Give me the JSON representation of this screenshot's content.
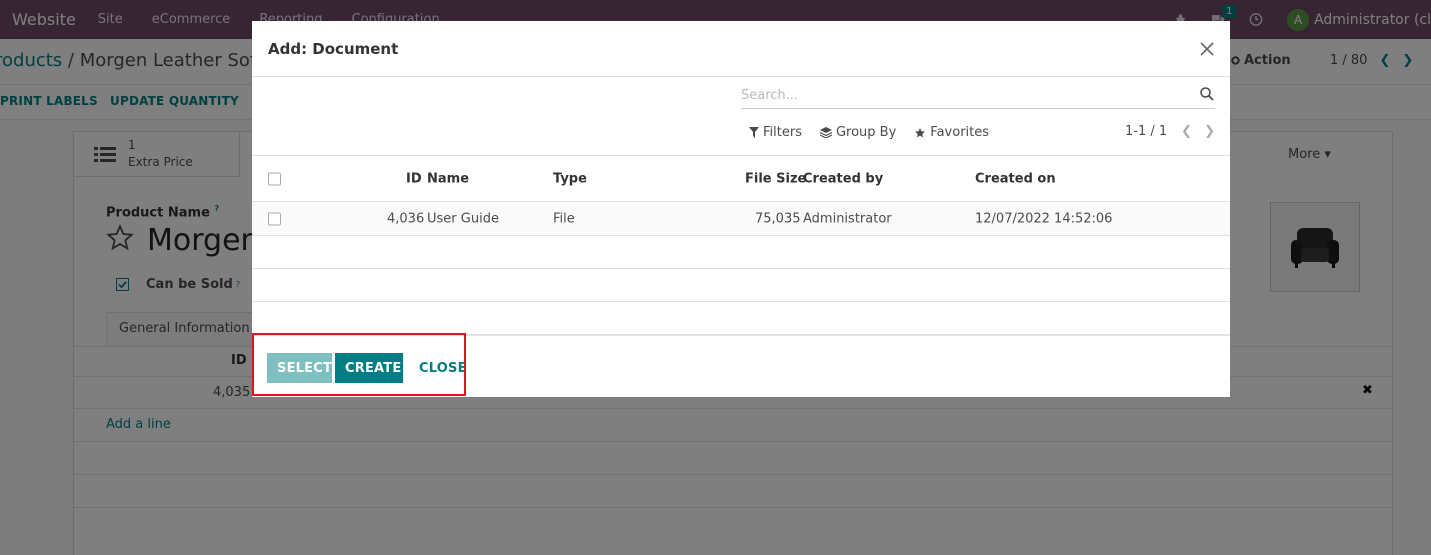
{
  "navbar": {
    "brand": "Website",
    "menu": [
      "Site",
      "eCommerce",
      "Reporting",
      "Configuration"
    ],
    "chat_badge": "1",
    "avatar_letter": "A",
    "user": "Administrator (cl"
  },
  "control": {
    "breadcrumb_parent": "roducts",
    "breadcrumb_sep": " / ",
    "breadcrumb_current": "Morgen Leather Sofa",
    "action_label": "Action",
    "pager": "1 / 80"
  },
  "statusbar": {
    "print_labels": "PRINT LABELS",
    "update_quantity": "UPDATE QUANTITY"
  },
  "form": {
    "stat_value": "1",
    "stat_label": "Extra Price",
    "more_label": "More",
    "product_name_label": "Product Name",
    "help_mark": "?",
    "product_name": "Morgen",
    "can_be_sold": "Can be Sold",
    "tab_general": "General Information",
    "grid_id_header": "ID",
    "grid_row_id": "4,035",
    "add_line": "Add a line"
  },
  "modal": {
    "title": "Add: Document",
    "search_placeholder": "Search...",
    "filters": "Filters",
    "group_by": "Group By",
    "favorites": "Favorites",
    "pager": "1-1 / 1",
    "columns": {
      "id": "ID",
      "name": "Name",
      "type": "Type",
      "file_size": "File Size",
      "created_by": "Created by",
      "created_on": "Created on"
    },
    "row": {
      "id": "4,036",
      "name": "User Guide",
      "type": "File",
      "file_size": "75,035",
      "created_by": "Administrator",
      "created_on": "12/07/2022 14:52:06"
    },
    "buttons": {
      "select": "SELECT",
      "create": "CREATE",
      "close": "CLOSE"
    }
  },
  "colors": {
    "navbar": "#714b67",
    "primary": "#017e84",
    "primary_disabled": "#7fbec1",
    "highlight": "#e0141e"
  }
}
